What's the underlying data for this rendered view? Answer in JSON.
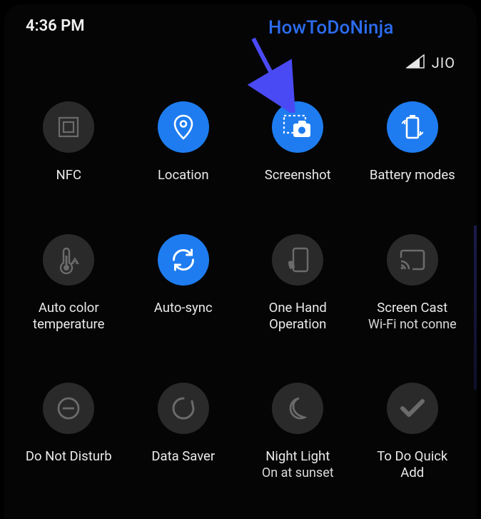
{
  "status": {
    "time": "4:36 PM"
  },
  "carrier": {
    "name": "JIO"
  },
  "annotation": {
    "text": "HowToDoNinja"
  },
  "tiles": {
    "r0c0": {
      "label": "NFC"
    },
    "r0c1": {
      "label": "Location"
    },
    "r0c2": {
      "label": "Screenshot"
    },
    "r0c3": {
      "label": "Battery modes"
    },
    "r1c0": {
      "label": "Auto color\ntemperature"
    },
    "r1c1": {
      "label": "Auto-sync"
    },
    "r1c2": {
      "label": "One Hand\nOperation"
    },
    "r1c3": {
      "label": "Screen Cast",
      "sub": "Wi-Fi not conne"
    },
    "r2c0": {
      "label": "Do Not Disturb"
    },
    "r2c1": {
      "label": "Data Saver"
    },
    "r2c2": {
      "label": "Night Light",
      "sub": "On at sunset"
    },
    "r2c3": {
      "label": "To Do Quick\nAdd"
    }
  },
  "colors": {
    "accent": "#1e7cf0",
    "annotation": "#2c6cf0",
    "tile_off": "#2a2a2a"
  }
}
